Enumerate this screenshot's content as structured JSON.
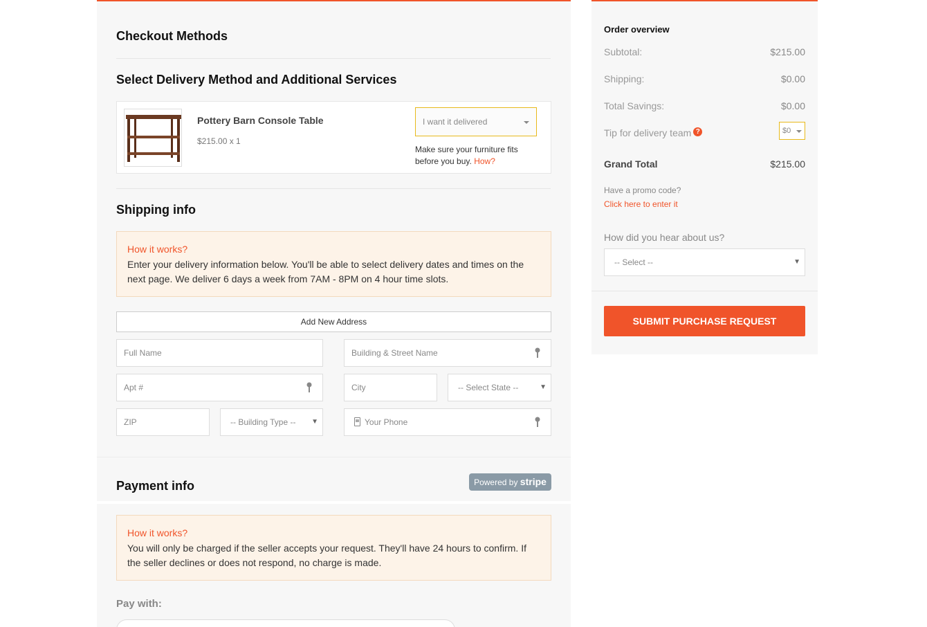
{
  "sections": {
    "checkout_methods": "Checkout Methods",
    "delivery_method": "Select Delivery Method and Additional Services",
    "shipping_info": "Shipping info",
    "payment_info": "Payment info"
  },
  "product": {
    "name": "Pottery Barn Console Table",
    "price_qty": "$215.00 x 1",
    "delivery_select_value": "I want it delivered",
    "fit_note": "Make sure your furniture fits before you buy.",
    "how_link": "How?"
  },
  "shipping": {
    "info_title": "How it works?",
    "info_text": "Enter your delivery information below. You'll be able to select delivery dates and times on the next page. We deliver 6 days a week from 7AM - 8PM on 4 hour time slots.",
    "add_address": "Add New Address",
    "fields": {
      "full_name": "Full Name",
      "street": "Building & Street Name",
      "apt": "Apt #",
      "city": "City",
      "state": "-- Select State --",
      "zip": "ZIP",
      "building_type": "-- Building Type --",
      "phone": "Your Phone"
    }
  },
  "payment": {
    "stripe_prefix": "Powered by",
    "stripe_brand": "stripe",
    "info_title": "How it works?",
    "info_text": "You will only be charged if the seller accepts your request. They'll have 24 hours to confirm. If the seller declines or does not respond, no charge is made.",
    "pay_with": "Pay with:"
  },
  "overview": {
    "title": "Order overview",
    "subtotal_label": "Subtotal:",
    "subtotal_value": "$215.00",
    "shipping_label": "Shipping:",
    "shipping_value": "$0.00",
    "savings_label": "Total Savings:",
    "savings_value": "$0.00",
    "tip_label": "Tip for delivery team",
    "tip_value": "$0",
    "grand_label": "Grand Total",
    "grand_value": "$215.00",
    "promo_question": "Have a promo code?",
    "promo_link": "Click here to enter it",
    "hear_label": "How did you hear about us?",
    "hear_select": "-- Select --",
    "submit": "SUBMIT PURCHASE REQUEST"
  },
  "colors": {
    "accent": "#f0542a",
    "highlight_border": "#e8b91a",
    "info_bg": "#fdf3e8",
    "stripe_badge": "#8a9aa6"
  }
}
